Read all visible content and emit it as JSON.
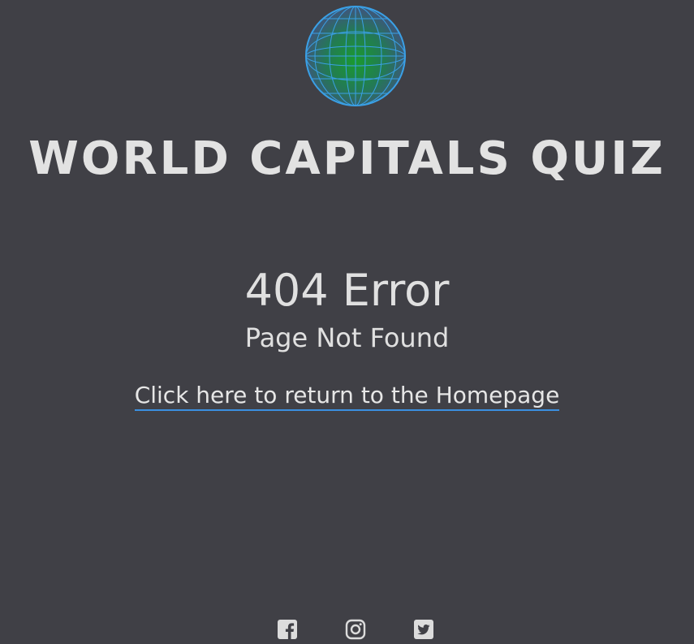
{
  "header": {
    "logo_icon": "globe-icon",
    "title": "World Capitals Quiz"
  },
  "error": {
    "code": "404 Error",
    "message": "Page Not Found",
    "home_link": "Click here to return to the Homepage"
  },
  "footer": {
    "social": [
      {
        "icon": "facebook-icon"
      },
      {
        "icon": "instagram-icon"
      },
      {
        "icon": "twitter-icon"
      }
    ]
  },
  "colors": {
    "background": "#404046",
    "text": "#dcdcdc",
    "link_underline": "#3b8fe0",
    "globe_lines": "#3aa0e6",
    "globe_fill": "#1f8a3a"
  }
}
